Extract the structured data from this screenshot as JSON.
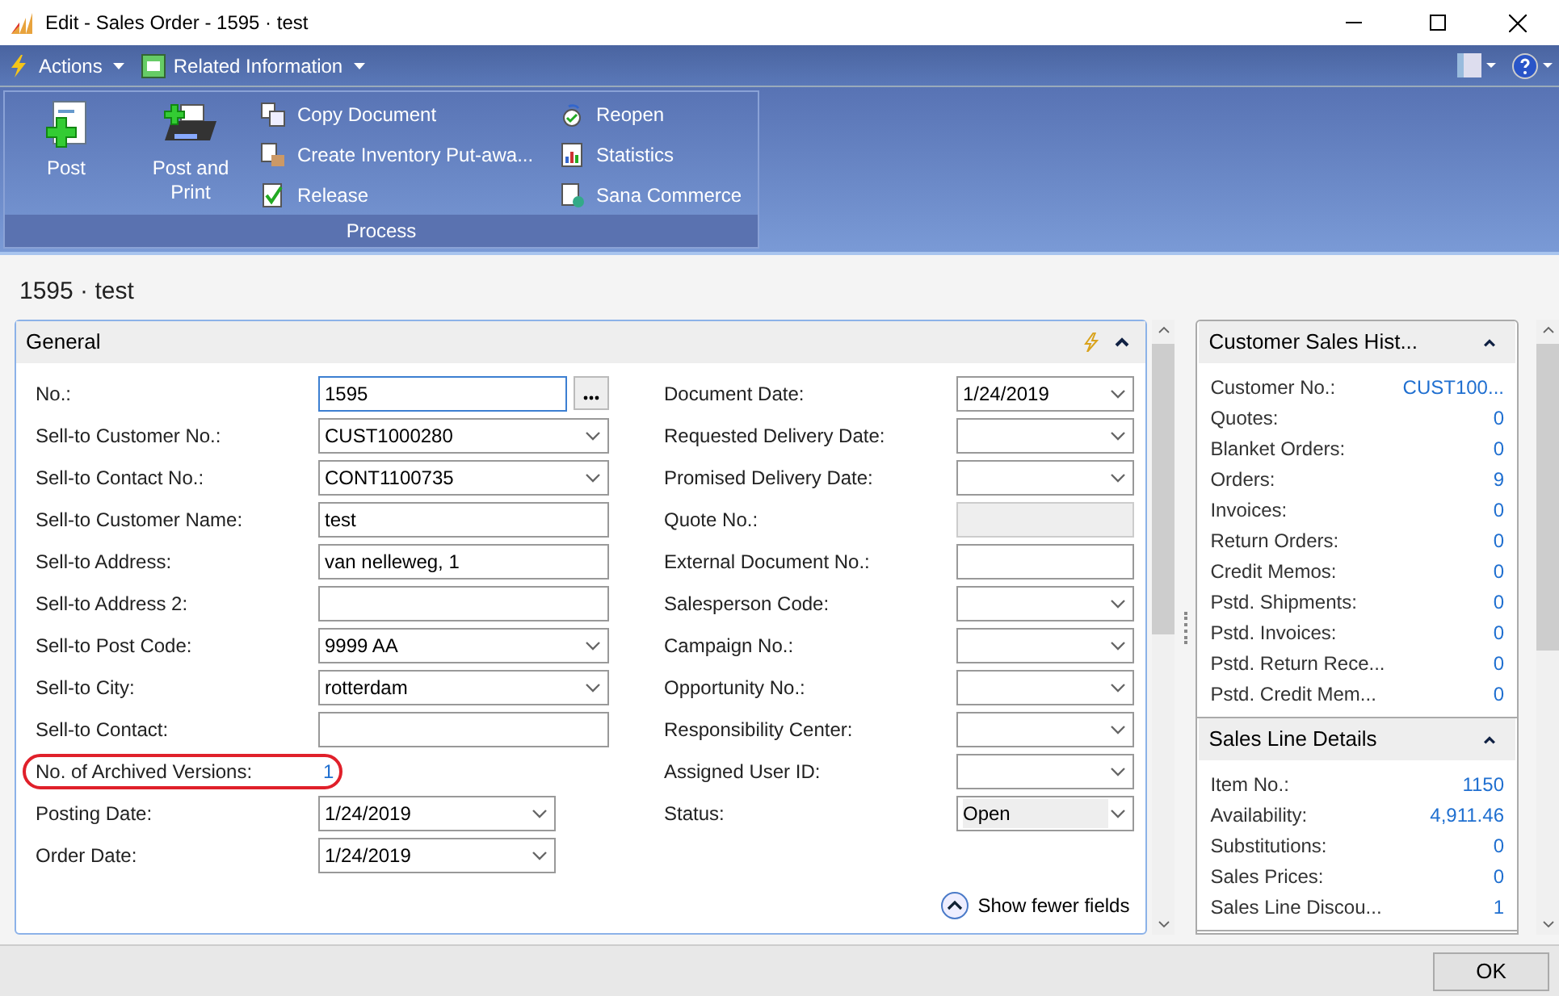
{
  "window": {
    "title": "Edit - Sales Order - 1595 · test"
  },
  "menu": [
    {
      "label": "Actions",
      "kind": "bolt"
    },
    {
      "label": "Related Information",
      "kind": "grid"
    }
  ],
  "ribbon": {
    "group": "Process",
    "large_actions": [
      {
        "label": "Post",
        "kind": "post"
      },
      {
        "label": "Post and Print",
        "kind": "print"
      }
    ],
    "columns": [
      [
        {
          "label": "Copy Document",
          "kind": "copy"
        },
        {
          "label": "Create Inventory Put-awa...",
          "kind": "box"
        },
        {
          "label": "Release",
          "kind": "check"
        }
      ],
      [
        {
          "label": "Reopen",
          "kind": "reopen"
        },
        {
          "label": "Statistics",
          "kind": "stats"
        },
        {
          "label": "Sana Commerce",
          "kind": "globe"
        }
      ]
    ]
  },
  "page_title": "1595 · test",
  "general": {
    "title": "General",
    "show_fewer": "Show fewer fields",
    "left": [
      {
        "label": "No.:",
        "value": "1595",
        "kind": "lookup",
        "focused": true
      },
      {
        "label": "Sell-to Customer No.:",
        "value": "CUST1000280",
        "kind": "dropdown"
      },
      {
        "label": "Sell-to Contact No.:",
        "value": "CONT1100735",
        "kind": "dropdown"
      },
      {
        "label": "Sell-to Customer Name:",
        "value": "test",
        "kind": "text"
      },
      {
        "label": "Sell-to Address:",
        "value": "van nelleweg, 1",
        "kind": "text"
      },
      {
        "label": "Sell-to Address 2:",
        "kind": "text"
      },
      {
        "label": "Sell-to Post Code:",
        "value": "9999 AA",
        "kind": "dropdown"
      },
      {
        "label": "Sell-to City:",
        "value": "rotterdam",
        "kind": "dropdown"
      },
      {
        "label": "Sell-to Contact:",
        "kind": "text"
      },
      {
        "label": "No. of Archived Versions:",
        "value": "1",
        "kind": "link",
        "circled": true
      },
      {
        "label": "Posting Date:",
        "value": "1/24/2019",
        "kind": "date"
      },
      {
        "label": "Order Date:",
        "value": "1/24/2019",
        "kind": "date"
      }
    ],
    "right": [
      {
        "label": "Document Date:",
        "value": "1/24/2019",
        "kind": "dropdown"
      },
      {
        "label": "Requested Delivery Date:",
        "kind": "dropdown"
      },
      {
        "label": "Promised Delivery Date:",
        "kind": "dropdown"
      },
      {
        "label": "Quote No.:",
        "kind": "readonly"
      },
      {
        "label": "External Document No.:",
        "kind": "text"
      },
      {
        "label": "Salesperson Code:",
        "kind": "dropdown"
      },
      {
        "label": "Campaign No.:",
        "kind": "dropdown"
      },
      {
        "label": "Opportunity No.:",
        "kind": "dropdown"
      },
      {
        "label": "Responsibility Center:",
        "kind": "dropdown"
      },
      {
        "label": "Assigned User ID:",
        "kind": "dropdown"
      },
      {
        "label": "Status:",
        "value": "Open",
        "kind": "option"
      }
    ]
  },
  "factboxes": [
    {
      "title": "Customer Sales Hist...",
      "rows": [
        {
          "label": "Customer No.:",
          "value": "CUST100..."
        },
        {
          "label": "Quotes:",
          "value": "0"
        },
        {
          "label": "Blanket Orders:",
          "value": "0"
        },
        {
          "label": "Orders:",
          "value": "9"
        },
        {
          "label": "Invoices:",
          "value": "0"
        },
        {
          "label": "Return Orders:",
          "value": "0"
        },
        {
          "label": "Credit Memos:",
          "value": "0"
        },
        {
          "label": "Pstd. Shipments:",
          "value": "0"
        },
        {
          "label": "Pstd. Invoices:",
          "value": "0"
        },
        {
          "label": "Pstd. Return Rece...",
          "value": "0"
        },
        {
          "label": "Pstd. Credit Mem...",
          "value": "0"
        }
      ]
    },
    {
      "title": "Sales Line Details",
      "rows": [
        {
          "label": "Item No.:",
          "value": "1150"
        },
        {
          "label": "Availability:",
          "value": "4,911.46"
        },
        {
          "label": "Substitutions:",
          "value": "0"
        },
        {
          "label": "Sales Prices:",
          "value": "0"
        },
        {
          "label": "Sales Line Discou...",
          "value": "1"
        }
      ]
    }
  ],
  "ok_button": "OK"
}
